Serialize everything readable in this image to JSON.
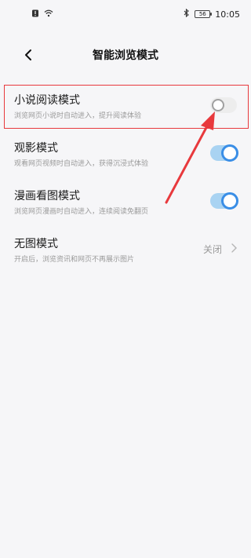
{
  "status_bar": {
    "time": "10:05",
    "battery": "56",
    "left_icons": [
      "alert-icon",
      "wifi-icon"
    ],
    "right_icons": [
      "bluetooth-icon",
      "battery-icon"
    ]
  },
  "header": {
    "title": "智能浏览模式"
  },
  "settings": [
    {
      "title": "小说阅读模式",
      "subtitle": "浏览网页小说时自动进入，提升阅读体验",
      "enabled": false
    },
    {
      "title": "观影模式",
      "subtitle": "观看网页视频时自动进入，获得沉浸式体验",
      "enabled": true
    },
    {
      "title": "漫画看图模式",
      "subtitle": "浏览网页漫画时自动进入，连续阅读免翻页",
      "enabled": true
    },
    {
      "title": "无图模式",
      "subtitle": "开启后，浏览资讯和网页不再展示图片",
      "value": "关闭"
    }
  ],
  "colors": {
    "accent": "#3a8ee6",
    "annotation": "#e8393d"
  }
}
